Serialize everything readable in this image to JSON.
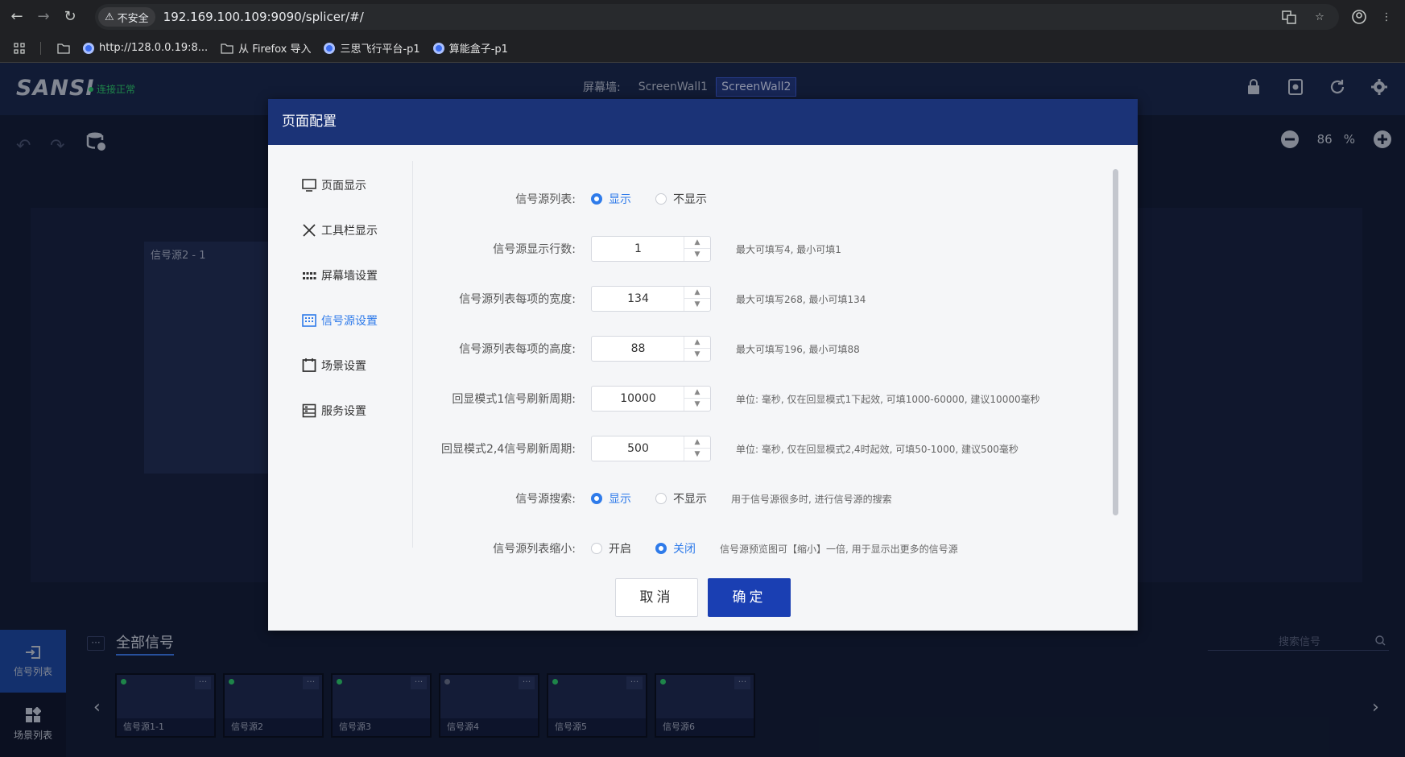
{
  "browser": {
    "security_label": "不安全",
    "url": "192.169.100.109:9090/splicer/#/",
    "bookmarks": [
      {
        "label": "http://128.0.0.19:8..."
      },
      {
        "label": "从 Firefox 导入"
      },
      {
        "label": "三思飞行平台-p1"
      },
      {
        "label": "算能盒子-p1"
      }
    ]
  },
  "app": {
    "logo": "SANSI",
    "connection_status": "连接正常",
    "screenwall_label": "屏幕墙:",
    "screenwalls": [
      "ScreenWall1",
      "ScreenWall2"
    ],
    "zoom_value": "86",
    "zoom_unit": "%",
    "panel_label": "信号源2 - 1",
    "sidebar": [
      {
        "label": "信号列表"
      },
      {
        "label": "场景列表"
      }
    ],
    "more_label": "···",
    "all_signals": "全部信号",
    "search_placeholder": "搜索信号",
    "thumbs": [
      {
        "label": "信号源1-1",
        "status": "on"
      },
      {
        "label": "信号源2",
        "status": "on"
      },
      {
        "label": "信号源3",
        "status": "on"
      },
      {
        "label": "信号源4",
        "status": "off"
      },
      {
        "label": "信号源5",
        "status": "on"
      },
      {
        "label": "信号源6",
        "status": "on"
      }
    ]
  },
  "modal": {
    "title": "页面配置",
    "nav": [
      {
        "label": "页面显示",
        "icon": "monitor-icon"
      },
      {
        "label": "工具栏显示",
        "icon": "tools-icon"
      },
      {
        "label": "屏幕墙设置",
        "icon": "grid-icon"
      },
      {
        "label": "信号源设置",
        "icon": "keyboard-icon",
        "active": true
      },
      {
        "label": "场景设置",
        "icon": "frame-icon"
      },
      {
        "label": "服务设置",
        "icon": "server-icon"
      }
    ],
    "fields": {
      "source_list": {
        "label": "信号源列表:",
        "opt_show": "显示",
        "opt_hide": "不显示"
      },
      "rows": {
        "label": "信号源显示行数:",
        "value": "1",
        "hint": "最大可填写4, 最小可填1"
      },
      "width": {
        "label": "信号源列表每项的宽度:",
        "value": "134",
        "hint": "最大可填写268, 最小可填134"
      },
      "height": {
        "label": "信号源列表每项的高度:",
        "value": "88",
        "hint": "最大可填写196, 最小可填88"
      },
      "mode1": {
        "label": "回显模式1信号刷新周期:",
        "value": "10000",
        "hint": "单位: 毫秒, 仅在回显模式1下起效, 可填1000-60000, 建议10000毫秒"
      },
      "mode24": {
        "label": "回显模式2,4信号刷新周期:",
        "value": "500",
        "hint": "单位: 毫秒, 仅在回显模式2,4时起效, 可填50-1000, 建议500毫秒"
      },
      "search": {
        "label": "信号源搜索:",
        "opt_show": "显示",
        "opt_hide": "不显示",
        "hint": "用于信号源很多时, 进行信号源的搜索"
      },
      "shrink": {
        "label": "信号源列表缩小:",
        "opt_on": "开启",
        "opt_off": "关闭",
        "hint": "信号源预览图可【缩小】一倍, 用于显示出更多的信号源"
      }
    },
    "cancel": "取消",
    "ok": "确定"
  }
}
